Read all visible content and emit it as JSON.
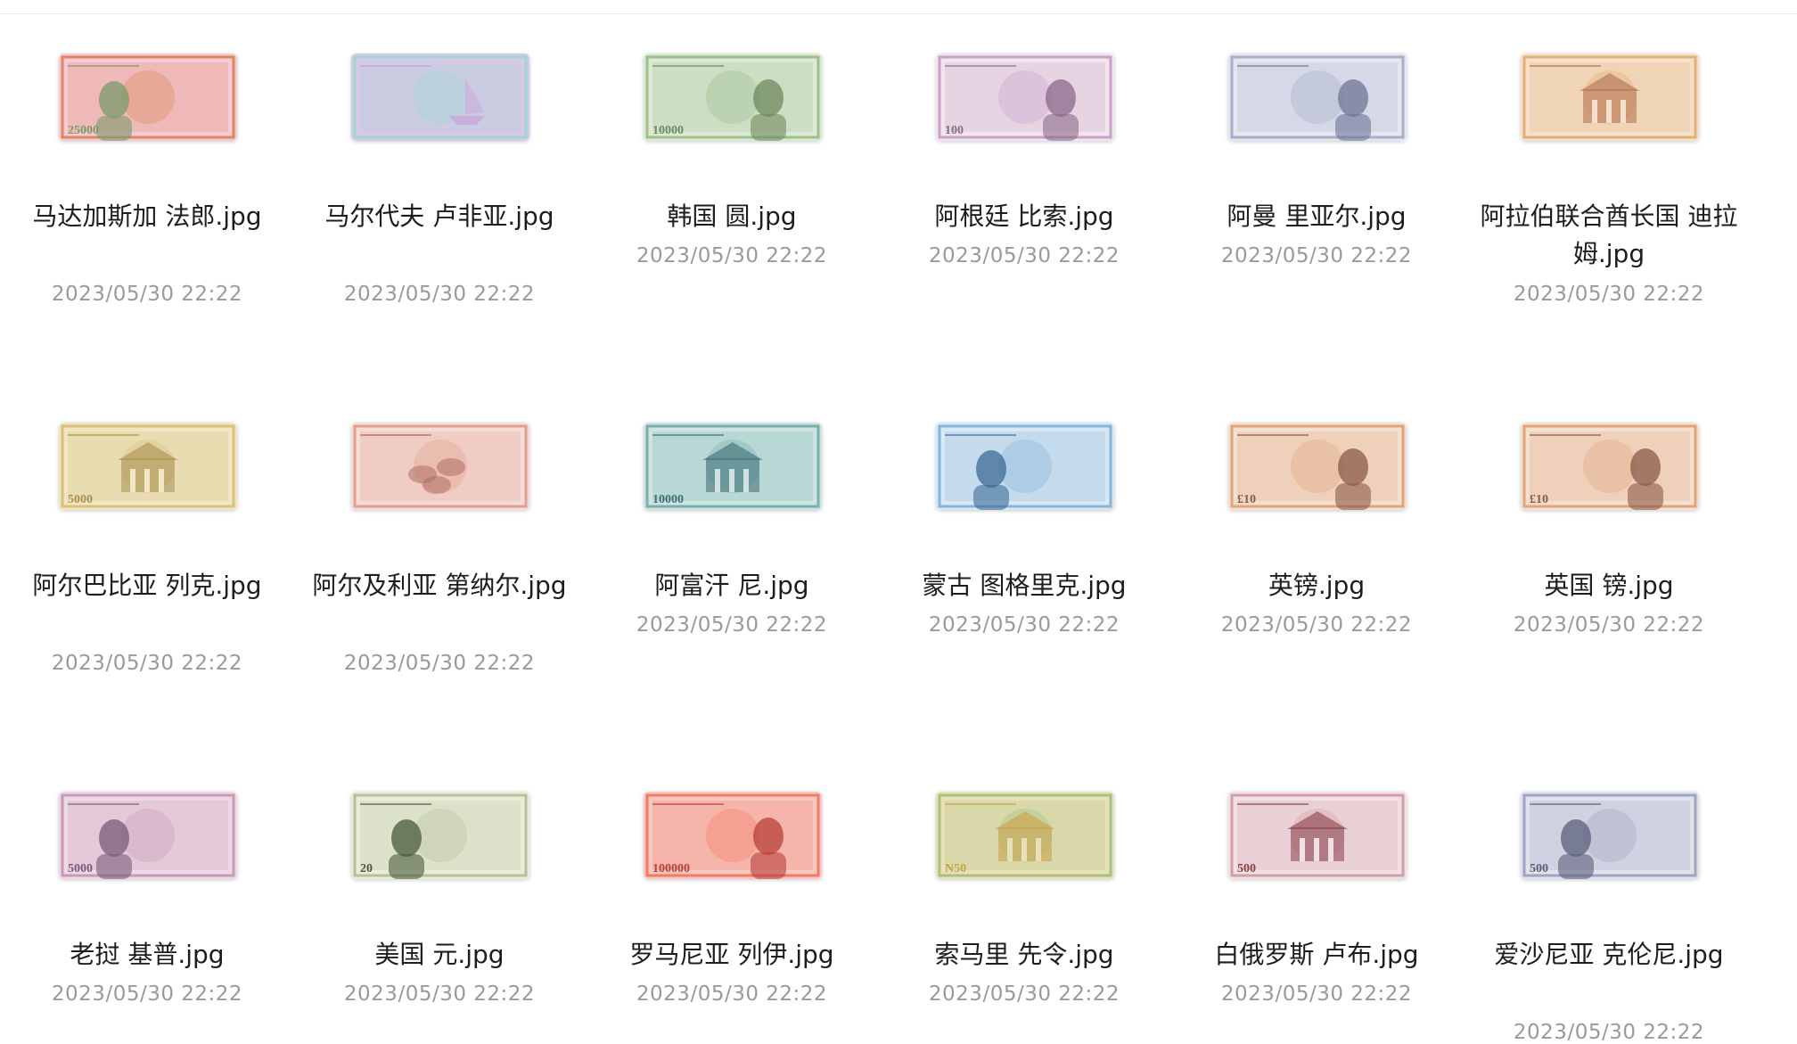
{
  "files": [
    {
      "name": "马达加斯加 法郎.jpg",
      "date": "2023/05/30 22:22",
      "colors": [
        "#f7c8d8",
        "#d98a5a",
        "#7a9a6a"
      ],
      "motif": "portrait-left",
      "label": "25000",
      "lines": 2
    },
    {
      "name": "马尔代夫 卢非亚.jpg",
      "date": "2023/05/30 22:22",
      "colors": [
        "#d8c8e8",
        "#9fd6d0",
        "#c9a3d8"
      ],
      "motif": "boat",
      "label": "",
      "lines": 2
    },
    {
      "name": "韩国 圆.jpg",
      "date": "2023/05/30 22:22",
      "colors": [
        "#dde9d4",
        "#9cbf8e",
        "#6f8a5c"
      ],
      "motif": "portrait-right",
      "label": "10000",
      "lines": 1
    },
    {
      "name": "阿根廷 比索.jpg",
      "date": "2023/05/30 22:22",
      "colors": [
        "#f2e6ec",
        "#c8a0c8",
        "#8a6a8a"
      ],
      "motif": "portrait-right",
      "label": "100",
      "lines": 1
    },
    {
      "name": "阿曼 里亚尔.jpg",
      "date": "2023/05/30 22:22",
      "colors": [
        "#e4e6f0",
        "#a8aec8",
        "#6e7496"
      ],
      "motif": "portrait-right",
      "label": "",
      "lines": 1
    },
    {
      "name": "阿拉伯联合酋长国 迪拉姆.jpg",
      "date": "2023/05/30 22:22",
      "colors": [
        "#f6e0cc",
        "#e0b078",
        "#b07050"
      ],
      "motif": "building",
      "label": "",
      "lines": 2
    },
    {
      "name": "阿尔巴比亚 列克.jpg",
      "date": "2023/05/30 22:22",
      "colors": [
        "#f0e6c2",
        "#d8c080",
        "#a89050"
      ],
      "motif": "building",
      "label": "5000",
      "lines": 2
    },
    {
      "name": "阿尔及利亚 第纳尔.jpg",
      "date": "2023/05/30 22:22",
      "colors": [
        "#f6dcd6",
        "#e0a090",
        "#a86858"
      ],
      "motif": "animals",
      "label": "",
      "lines": 2
    },
    {
      "name": "阿富汗 尼.jpg",
      "date": "2023/05/30 22:22",
      "colors": [
        "#cfe4e0",
        "#78aeae",
        "#3e6e74"
      ],
      "motif": "building",
      "label": "10000",
      "lines": 1
    },
    {
      "name": "蒙古 图格里克.jpg",
      "date": "2023/05/30 22:22",
      "colors": [
        "#d8e8f4",
        "#88b4d8",
        "#3e6a96"
      ],
      "motif": "portrait-left",
      "label": "",
      "lines": 1
    },
    {
      "name": "英镑.jpg",
      "date": "2023/05/30 22:22",
      "colors": [
        "#f4e0d0",
        "#e0a47c",
        "#8a5a48"
      ],
      "motif": "queen",
      "label": "£10",
      "lines": 1
    },
    {
      "name": "英国 镑.jpg",
      "date": "2023/05/30 22:22",
      "colors": [
        "#f4e0d0",
        "#e0a47c",
        "#8a5a48"
      ],
      "motif": "queen",
      "label": "£10",
      "lines": 1
    },
    {
      "name": "老挝 基普.jpg",
      "date": "2023/05/30 22:22",
      "colors": [
        "#eed8e4",
        "#c89ab8",
        "#7a5a78"
      ],
      "motif": "portrait-left",
      "label": "5000",
      "lines": 1
    },
    {
      "name": "美国 元.jpg",
      "date": "2023/05/30 22:22",
      "colors": [
        "#e8ecd8",
        "#b8c09a",
        "#4a5a3a"
      ],
      "motif": "portrait-left",
      "label": "20",
      "lines": 1
    },
    {
      "name": "罗马尼亚 列伊.jpg",
      "date": "2023/05/30 22:22",
      "colors": [
        "#f8c8c0",
        "#f07a68",
        "#b8403a"
      ],
      "motif": "portrait-right",
      "label": "100000",
      "lines": 1
    },
    {
      "name": "索马里 先令.jpg",
      "date": "2023/05/30 22:22",
      "colors": [
        "#e8e0b8",
        "#a8c080",
        "#c8a048"
      ],
      "motif": "building",
      "label": "N50",
      "lines": 1
    },
    {
      "name": "白俄罗斯 卢布.jpg",
      "date": "2023/05/30 22:22",
      "colors": [
        "#f2e0e4",
        "#d0a0a8",
        "#8a4048"
      ],
      "motif": "building",
      "label": "500",
      "lines": 1
    },
    {
      "name": "爱沙尼亚 克伦尼.jpg",
      "date": "2023/05/30 22:22",
      "colors": [
        "#e0e2ec",
        "#a0a4c0",
        "#5a5e7a"
      ],
      "motif": "portrait-left",
      "label": "500",
      "lines": 2
    }
  ]
}
